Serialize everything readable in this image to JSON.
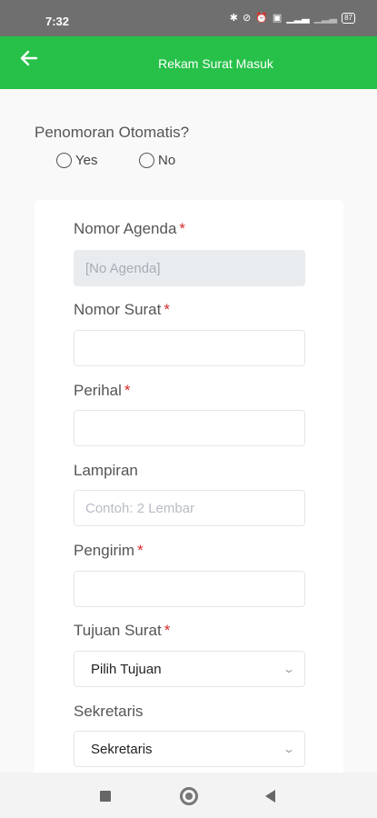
{
  "status_bar": {
    "time": "7:32",
    "battery": "87",
    "icons": [
      "bluetooth-icon",
      "mute-icon",
      "alarm-icon",
      "message-icon",
      "signal-icon",
      "signal-weak-icon",
      "battery-icon"
    ]
  },
  "app_bar": {
    "title": "Rekam Surat Masuk",
    "back_icon": "arrow-left-icon",
    "color": "#27c149"
  },
  "auto_numbering": {
    "label": "Penomoran Otomatis?",
    "options": [
      "Yes",
      "No"
    ]
  },
  "form": {
    "agenda": {
      "label": "Nomor Agenda",
      "required_mark": "*",
      "placeholder": "[No Agenda]"
    },
    "surat": {
      "label": "Nomor Surat",
      "required_mark": "*",
      "value": ""
    },
    "perihal": {
      "label": "Perihal",
      "required_mark": "*",
      "value": ""
    },
    "lampiran": {
      "label": "Lampiran",
      "placeholder": "Contoh: 2 Lembar"
    },
    "pengirim": {
      "label": "Pengirim",
      "required_mark": "*",
      "value": ""
    },
    "tujuan": {
      "label": "Tujuan Surat",
      "required_mark": "*",
      "selected": "Pilih Tujuan"
    },
    "sekretaris": {
      "label": "Sekretaris",
      "selected": "Sekretaris"
    }
  },
  "accent_colors": {
    "required": "#d62c2c",
    "disabled_bg": "#e9ecef"
  }
}
